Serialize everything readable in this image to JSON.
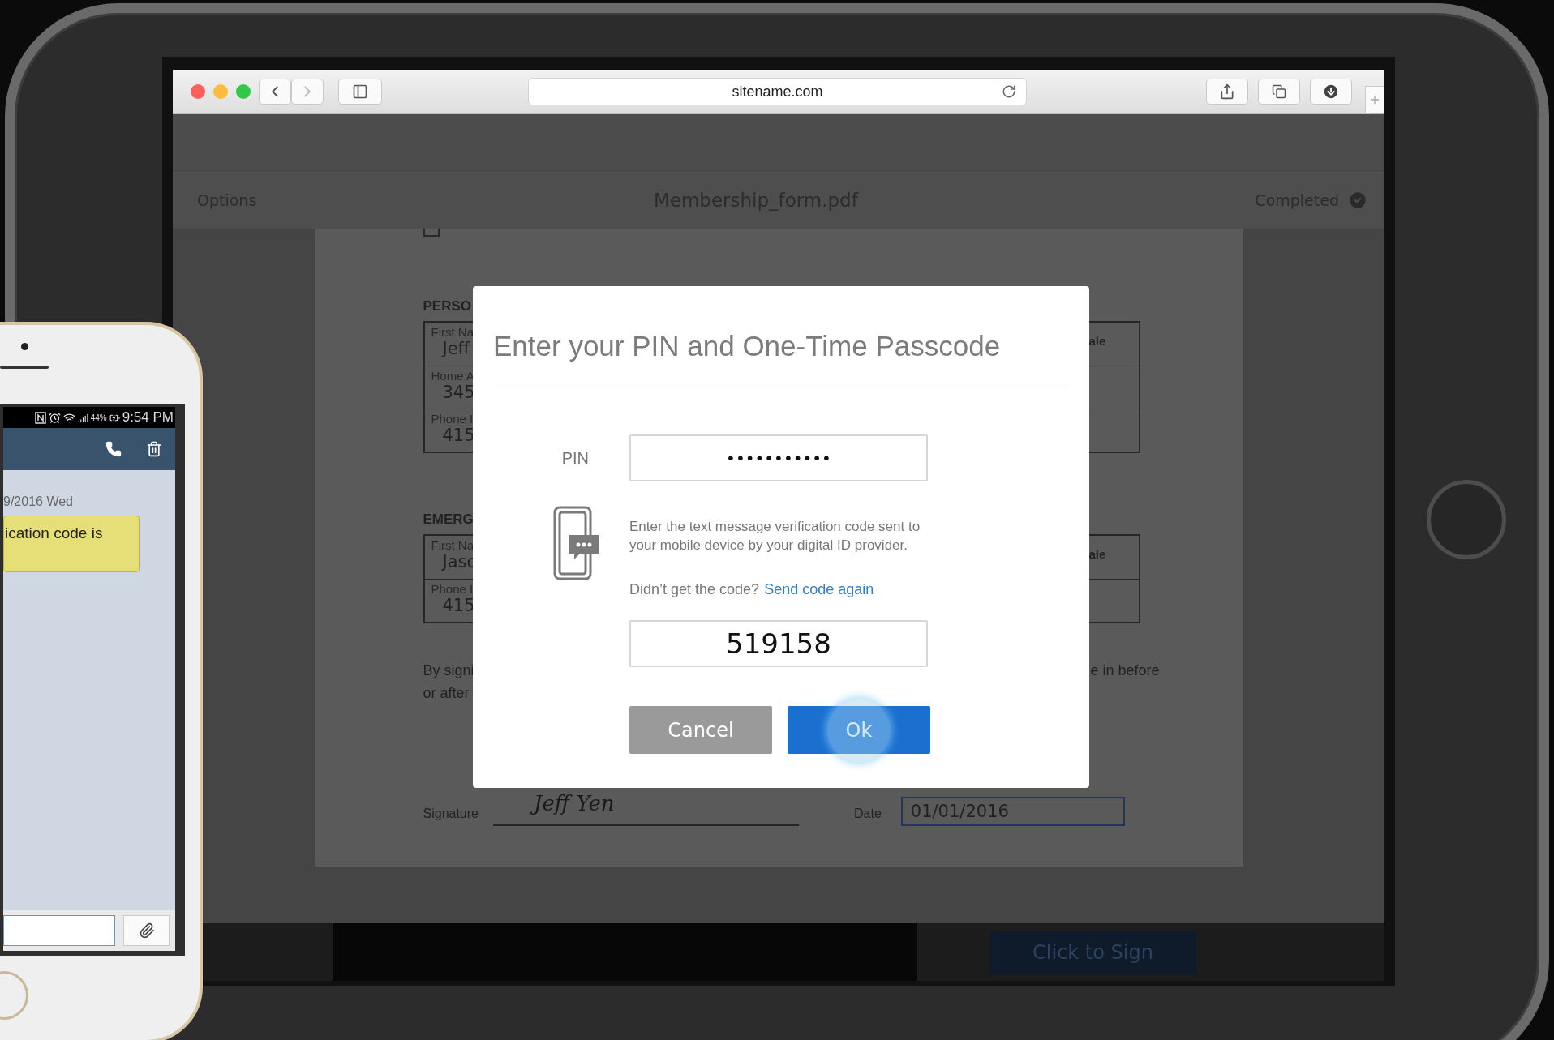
{
  "browser": {
    "url": "sitename.com"
  },
  "app_header": {
    "options": "Options",
    "title": "Membership_form.pdf",
    "status": "Completed"
  },
  "document": {
    "top_checkbox": {
      "checked": false
    },
    "sections": [
      {
        "heading": "PERSO",
        "rows": [
          {
            "label": "First Na",
            "value": "Jeff",
            "right": "ale"
          },
          {
            "label": "Home A",
            "value": "345"
          },
          {
            "label": "Phone I",
            "value": "415"
          }
        ]
      },
      {
        "heading": "EMERG",
        "rows": [
          {
            "label": "First Na",
            "value": "Jaso",
            "right": "ale"
          },
          {
            "label": "Phone I",
            "value": "415"
          }
        ]
      }
    ],
    "consent_lines": [
      "By signi",
      "or after"
    ],
    "consent_right": "e in before",
    "signature_label": "Signature",
    "signature": "Jeff Yen",
    "date_label": "Date",
    "date": "01/01/2016"
  },
  "dialog": {
    "title": "Enter your PIN and One-Time Passcode",
    "pin_label": "PIN",
    "pin_value": "•••••••••••",
    "message": "Enter the text message verification code sent to your mobile device by your digital ID provider.",
    "resend_prompt": "Didn’t get the code?",
    "resend_link": "Send code again",
    "code": "519158",
    "buttons": [
      {
        "label": "Cancel",
        "kind": "secondary",
        "pressed": false
      },
      {
        "label": "Ok",
        "kind": "primary",
        "pressed": true
      }
    ]
  },
  "bottom_bar": {
    "button": "Click to Sign"
  },
  "phone": {
    "battery": "44%",
    "time": "9:54 PM",
    "date": "9/2016 Wed",
    "message": "ication code is"
  }
}
